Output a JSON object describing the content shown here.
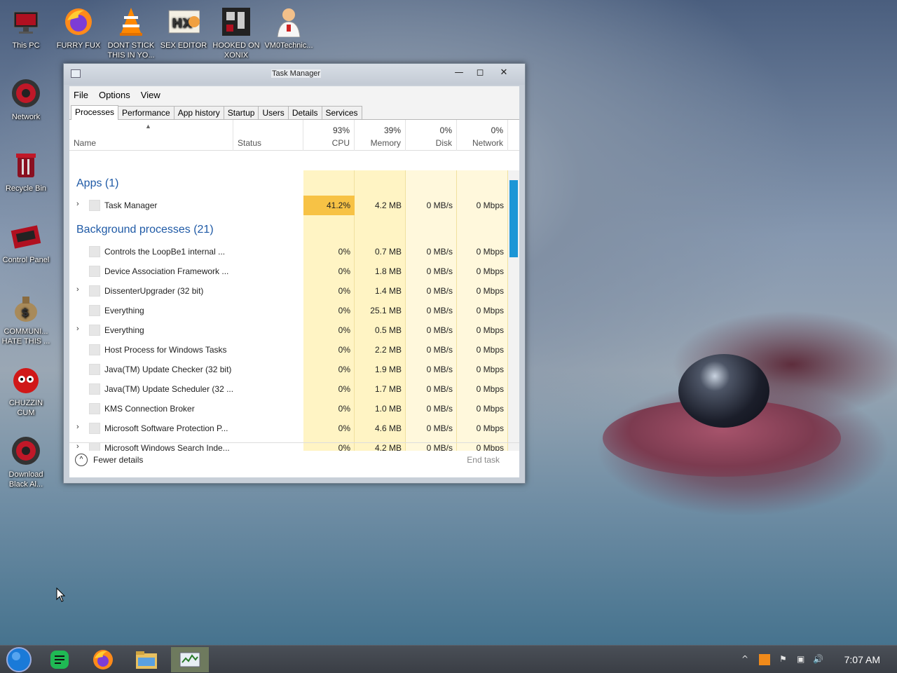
{
  "desktop": {
    "icons": [
      {
        "label": "This PC"
      },
      {
        "label": "FURRY FUX"
      },
      {
        "label": "DONT STICK THIS IN YO..."
      },
      {
        "label": "SEX EDITOR"
      },
      {
        "label": "HOOKED ON XONIX"
      },
      {
        "label": "VM0Technic..."
      },
      {
        "label": "Network"
      },
      {
        "label": "Recycle Bin"
      },
      {
        "label": "Control Panel"
      },
      {
        "label": "COMMUNI... HATE THIS ..."
      },
      {
        "label": "CHUZZIN CUM"
      },
      {
        "label": "Download Black Al..."
      }
    ]
  },
  "window": {
    "title": "Task Manager",
    "menu": [
      "File",
      "Options",
      "View"
    ],
    "tabs": [
      "Processes",
      "Performance",
      "App history",
      "Startup",
      "Users",
      "Details",
      "Services"
    ],
    "active_tab": "Processes",
    "columns": {
      "name": "Name",
      "status": "Status",
      "cpu": {
        "pct": "93%",
        "label": "CPU"
      },
      "memory": {
        "pct": "39%",
        "label": "Memory"
      },
      "disk": {
        "pct": "0%",
        "label": "Disk"
      },
      "network": {
        "pct": "0%",
        "label": "Network"
      }
    },
    "groups": {
      "apps": "Apps (1)",
      "background": "Background processes (21)"
    },
    "apps": [
      {
        "name": "Task Manager",
        "expandable": true,
        "cpu": "41.2%",
        "memory": "4.2 MB",
        "disk": "0 MB/s",
        "network": "0 Mbps"
      }
    ],
    "background": [
      {
        "name": "Controls the LoopBe1 internal ...",
        "expandable": false,
        "cpu": "0%",
        "memory": "0.7 MB",
        "disk": "0 MB/s",
        "network": "0 Mbps"
      },
      {
        "name": "Device Association Framework ...",
        "expandable": false,
        "cpu": "0%",
        "memory": "1.8 MB",
        "disk": "0 MB/s",
        "network": "0 Mbps"
      },
      {
        "name": "DissenterUpgrader (32 bit)",
        "expandable": true,
        "cpu": "0%",
        "memory": "1.4 MB",
        "disk": "0 MB/s",
        "network": "0 Mbps"
      },
      {
        "name": "Everything",
        "expandable": false,
        "cpu": "0%",
        "memory": "25.1 MB",
        "disk": "0 MB/s",
        "network": "0 Mbps"
      },
      {
        "name": "Everything",
        "expandable": true,
        "cpu": "0%",
        "memory": "0.5 MB",
        "disk": "0 MB/s",
        "network": "0 Mbps"
      },
      {
        "name": "Host Process for Windows Tasks",
        "expandable": false,
        "cpu": "0%",
        "memory": "2.2 MB",
        "disk": "0 MB/s",
        "network": "0 Mbps"
      },
      {
        "name": "Java(TM) Update Checker (32 bit)",
        "expandable": false,
        "cpu": "0%",
        "memory": "1.9 MB",
        "disk": "0 MB/s",
        "network": "0 Mbps"
      },
      {
        "name": "Java(TM) Update Scheduler (32 ...",
        "expandable": false,
        "cpu": "0%",
        "memory": "1.7 MB",
        "disk": "0 MB/s",
        "network": "0 Mbps"
      },
      {
        "name": "KMS Connection Broker",
        "expandable": false,
        "cpu": "0%",
        "memory": "1.0 MB",
        "disk": "0 MB/s",
        "network": "0 Mbps"
      },
      {
        "name": "Microsoft Software Protection P...",
        "expandable": true,
        "cpu": "0%",
        "memory": "4.6 MB",
        "disk": "0 MB/s",
        "network": "0 Mbps"
      },
      {
        "name": "Microsoft Windows Search Inde...",
        "expandable": true,
        "cpu": "0%",
        "memory": "4.2 MB",
        "disk": "0 MB/s",
        "network": "0 Mbps"
      }
    ],
    "footer": {
      "fewer": "Fewer details",
      "end_task": "End task"
    }
  },
  "taskbar": {
    "clock": "7:07 AM"
  },
  "colors": {
    "cpu_high": "#f7c245",
    "col_tint": "#fff4c4",
    "group_blue": "#1f5aa6",
    "scroll_thumb": "#1c96d6"
  }
}
